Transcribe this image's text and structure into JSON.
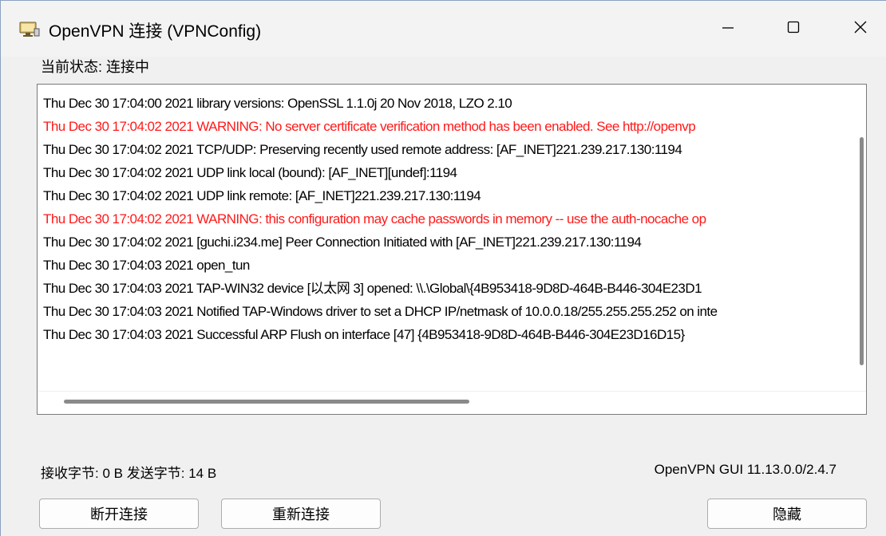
{
  "window": {
    "title": "OpenVPN 连接 (VPNConfig)",
    "icon": "monitor-network-icon",
    "controls": {
      "minimize_icon": "minimize-icon",
      "maximize_icon": "maximize-icon",
      "close_icon": "close-icon"
    }
  },
  "status": {
    "label": "当前状态:",
    "value": "连接中"
  },
  "log": {
    "lines": [
      {
        "text": "Thu Dec 30 17:04:00 2021 library versions: OpenSSL 1.1.0j  20 Nov 2018, LZO 2.10",
        "level": "info"
      },
      {
        "text": "Thu Dec 30 17:04:02 2021 WARNING: No server certificate verification method has been enabled.  See http://openvp",
        "level": "warning"
      },
      {
        "text": "Thu Dec 30 17:04:02 2021 TCP/UDP: Preserving recently used remote address: [AF_INET]221.239.217.130:1194",
        "level": "info"
      },
      {
        "text": "Thu Dec 30 17:04:02 2021 UDP link local (bound): [AF_INET][undef]:1194",
        "level": "info"
      },
      {
        "text": "Thu Dec 30 17:04:02 2021 UDP link remote: [AF_INET]221.239.217.130:1194",
        "level": "info"
      },
      {
        "text": "Thu Dec 30 17:04:02 2021 WARNING: this configuration may cache passwords in memory -- use the auth-nocache op",
        "level": "warning"
      },
      {
        "text": "Thu Dec 30 17:04:02 2021 [guchi.i234.me] Peer Connection Initiated with [AF_INET]221.239.217.130:1194",
        "level": "info"
      },
      {
        "text": "Thu Dec 30 17:04:03 2021 open_tun",
        "level": "info"
      },
      {
        "text": "Thu Dec 30 17:04:03 2021 TAP-WIN32 device [以太网 3] opened: \\\\.\\Global\\{4B953418-9D8D-464B-B446-304E23D1",
        "level": "info"
      },
      {
        "text": "Thu Dec 30 17:04:03 2021 Notified TAP-Windows driver to set a DHCP IP/netmask of 10.0.0.18/255.255.255.252 on inte",
        "level": "info"
      },
      {
        "text": "Thu Dec 30 17:04:03 2021 Successful ARP Flush on interface [47] {4B953418-9D8D-464B-B446-304E23D16D15}",
        "level": "info"
      }
    ],
    "warning_color": "#ff1a1a",
    "highlight_color": "#a81e1e"
  },
  "stats": {
    "received_label": "接收字节:",
    "received_value": "0 B",
    "sent_label": "发送字节:",
    "sent_value": "14 B"
  },
  "version": "OpenVPN GUI 11.13.0.0/2.4.7",
  "buttons": {
    "disconnect": "断开连接",
    "reconnect": "重新连接",
    "hide": "隐藏"
  }
}
